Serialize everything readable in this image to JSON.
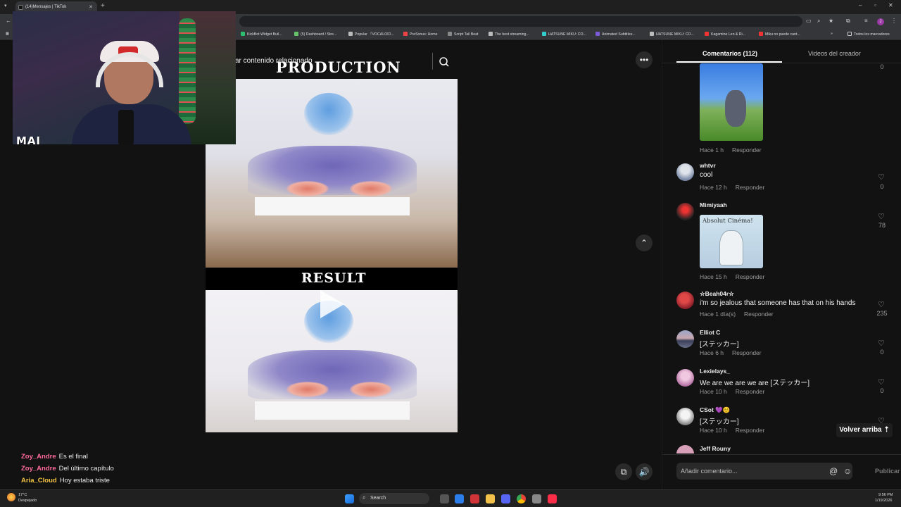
{
  "browser": {
    "tab_title": "(14)Mensajes | TikTok",
    "bookmarks": [
      "KickBot Widget Buil...",
      "(5) Dashboard / Stre...",
      "Popular 「VOCALOID...",
      "PreSonus: Home",
      "Script Tail Beat",
      "The best streaming...",
      "HATSUNE MIKU: CO...",
      "Animated Subtitles...",
      "HATSUNE MIKU: CO...",
      "Kagamine Len & Ri...",
      "Miku no puede cant..."
    ],
    "all_bookmarks": "Todos los marcadores",
    "profile_initial": "J"
  },
  "webcam": {
    "label": "MAI"
  },
  "video": {
    "search_text": "ar contenido relacionado",
    "title_top": "PRODUCTION",
    "title_mid": "RESULT"
  },
  "chat": [
    {
      "user": "Zoy_Andre",
      "message": "Es el final",
      "color": "#ff6b9d"
    },
    {
      "user": "Zoy_Andre",
      "message": "Del último capítulo",
      "color": "#ff6b9d"
    },
    {
      "user": "Aria_Cloud",
      "message": "Hoy estaba triste",
      "color": "#f5c542"
    }
  ],
  "panel": {
    "tab_comments": "Comentarios (112)",
    "tab_creator": "Videos del creador",
    "comments": [
      {
        "name": "",
        "text": "",
        "time": "Hace 1 h",
        "likes": "0"
      },
      {
        "name": "whtvr",
        "text": "cool",
        "time": "Hace 12 h",
        "likes": "0"
      },
      {
        "name": "Mimiyaah",
        "text": "",
        "time": "Hace 15 h",
        "likes": "78",
        "image_text": "Absolut Cinéma!"
      },
      {
        "name": "☆Beah04r☆",
        "text": "i'm so jealous that someone has that on his hands",
        "time": "Hace 1 día(s)",
        "likes": "235"
      },
      {
        "name": "Elliot C",
        "text": "[ステッカー]",
        "time": "Hace 6 h",
        "likes": "0"
      },
      {
        "name": "Lexielays_",
        "text": "We are we are we are [ステッカー]",
        "time": "Hace 10 h",
        "likes": "0"
      },
      {
        "name": "CSot 💜😊",
        "text": "[ステッカー]",
        "time": "Hace 10 h",
        "likes": ""
      },
      {
        "name": "Jeff Rouny",
        "text": "",
        "time": "",
        "likes": ""
      }
    ],
    "reply_label": "Responder",
    "scroll_top": "Volver arriba ⇡",
    "composer_placeholder": "Añadir comentario...",
    "publish": "Publicar"
  },
  "taskbar": {
    "weather_temp": "17°C",
    "weather_desc": "Despejado",
    "search_label": "Search",
    "time": "9:56 PM",
    "date": "1/19/2026"
  }
}
